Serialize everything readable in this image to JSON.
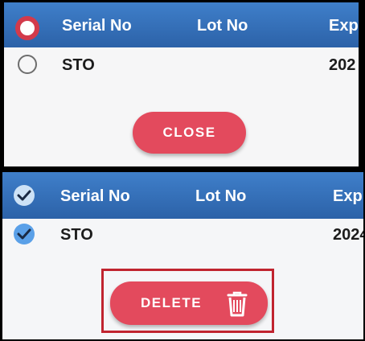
{
  "top_panel": {
    "columns": [
      "Serial No",
      "Lot No",
      "Exp"
    ],
    "row": {
      "serial": "STO",
      "exp": "202"
    },
    "close_label": "CLOSE"
  },
  "bottom_panel": {
    "columns": [
      "Serial No",
      "Lot No",
      "Exp"
    ],
    "row": {
      "serial": "STO",
      "exp": "2024"
    },
    "delete_label": "DELETE"
  },
  "colors": {
    "header_blue": "#2f6bb5",
    "button_red": "#e34a5d",
    "highlight_red": "#c0242f",
    "check_blue": "#5aa0e8"
  },
  "icons": {
    "select_all_top": "radio-selected-icon",
    "row_radio_top": "radio-empty-icon",
    "select_all_bottom": "check-circle-icon",
    "row_check_bottom": "check-circle-icon",
    "delete": "trash-icon"
  }
}
